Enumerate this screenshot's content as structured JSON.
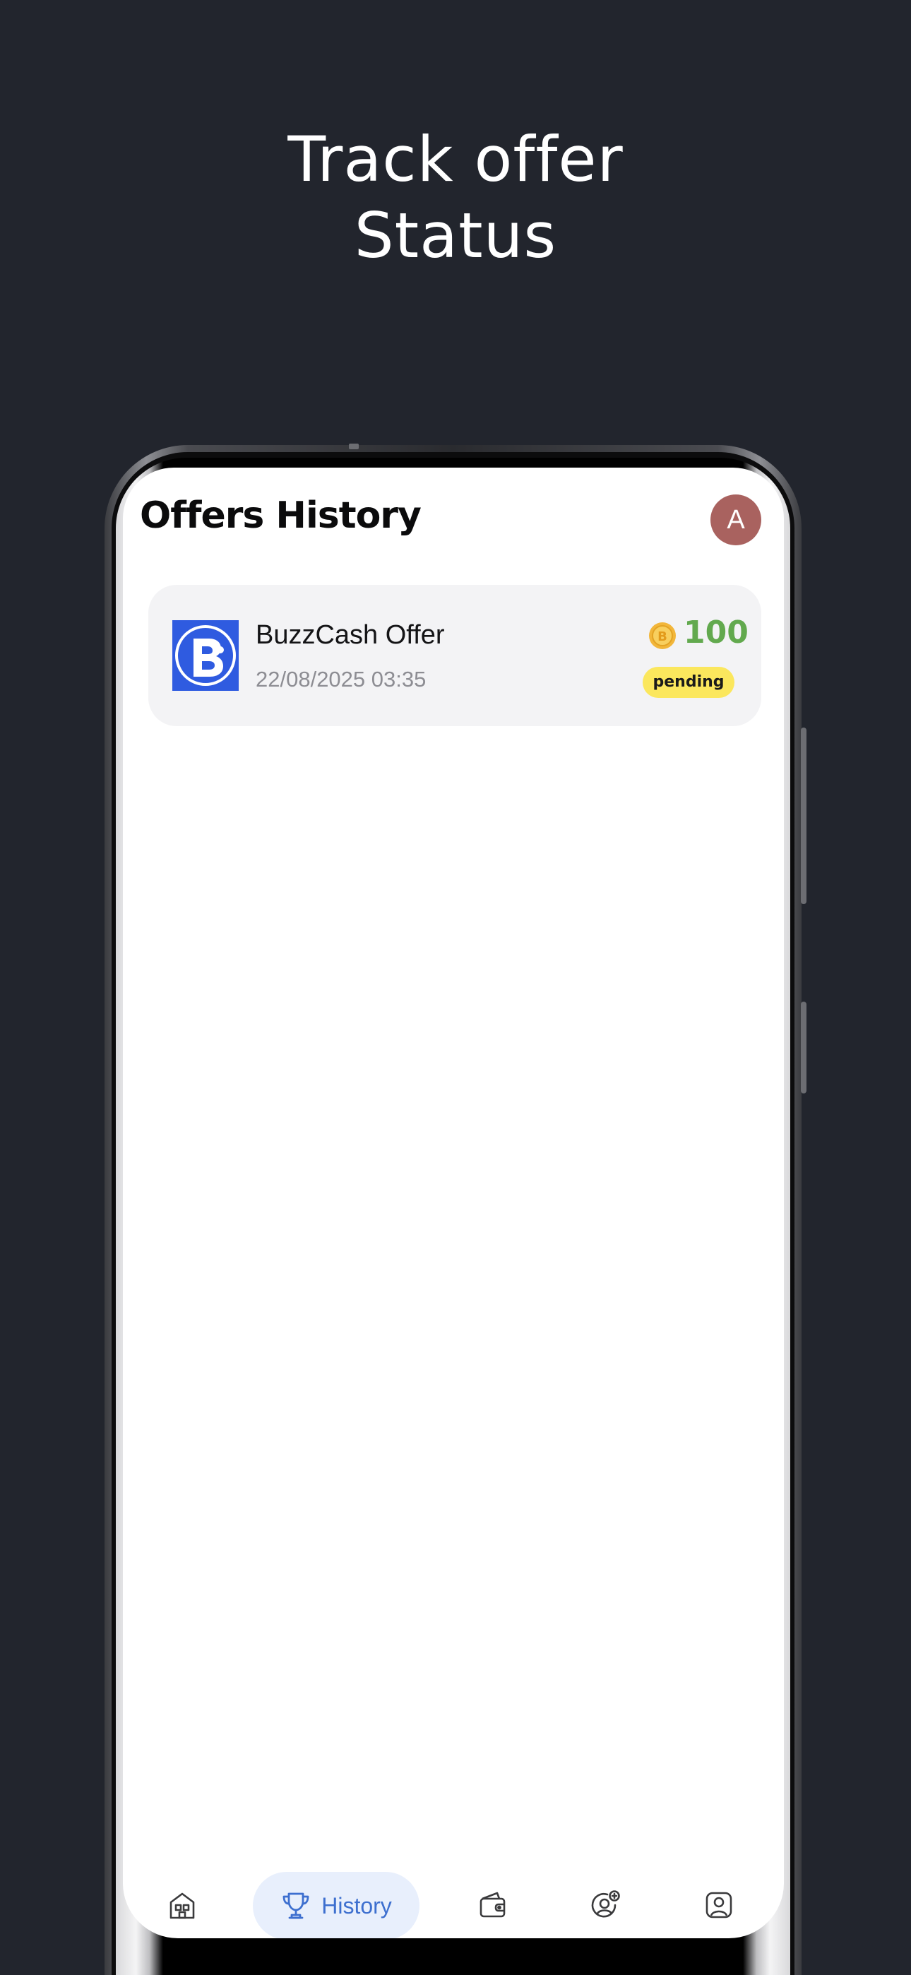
{
  "promo": {
    "headline_line1": "Track offer",
    "headline_line2": "Status"
  },
  "header": {
    "title": "Offers History",
    "avatar_initial": "A",
    "avatar_color": "#a9625f"
  },
  "offers": [
    {
      "name": "BuzzCash Offer",
      "date": "22/08/2025 03:35",
      "amount": "100",
      "status": "pending",
      "logo_icon": "buzzcash-logo",
      "coin_icon": "coin-icon"
    }
  ],
  "nav": {
    "items": [
      {
        "icon": "home-icon",
        "active": false
      },
      {
        "icon": "trophy-icon",
        "label": "History",
        "active": true
      },
      {
        "icon": "wallet-icon",
        "active": false
      },
      {
        "icon": "referral-user-icon",
        "active": false
      },
      {
        "icon": "profile-icon",
        "active": false
      }
    ],
    "active_color": "#3d6fcf"
  },
  "colors": {
    "background": "#22252d",
    "amount_green": "#62a94e",
    "pending_yellow": "#fbe75d",
    "card_bg": "#f3f3f5"
  }
}
